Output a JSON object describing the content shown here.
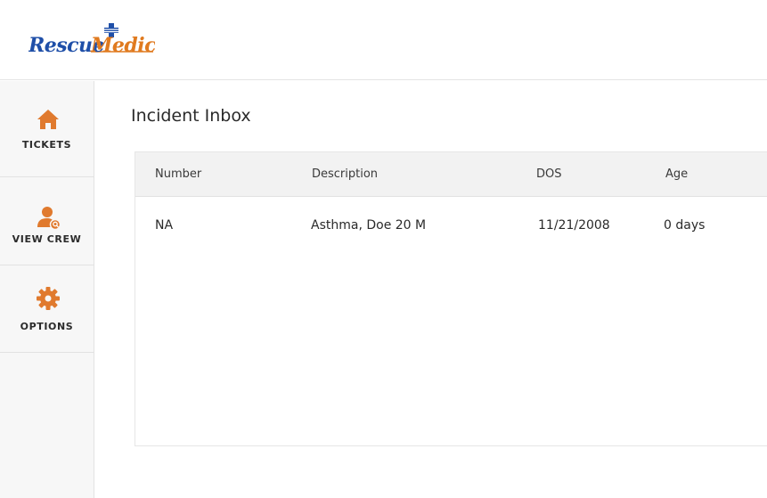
{
  "header": {
    "logo": {
      "text_part1": "Rescue",
      "text_part2": "Medic",
      "colors": {
        "blue": "#1f4fa8",
        "orange": "#e07a1f"
      }
    }
  },
  "sidebar": {
    "items": [
      {
        "label": "TICKETS",
        "icon": "home-icon"
      },
      {
        "label": "VIEW CREW",
        "icon": "user-search-icon"
      },
      {
        "label": "OPTIONS",
        "icon": "gear-icon"
      }
    ],
    "icon_color": "#e07a2e"
  },
  "main": {
    "title": "Incident Inbox",
    "table": {
      "columns": [
        "Number",
        "Description",
        "DOS",
        "Age"
      ],
      "rows": [
        {
          "number": "NA",
          "description": "Asthma, Doe 20 M",
          "dos": "11/21/2008",
          "age": "0 days"
        }
      ]
    }
  }
}
